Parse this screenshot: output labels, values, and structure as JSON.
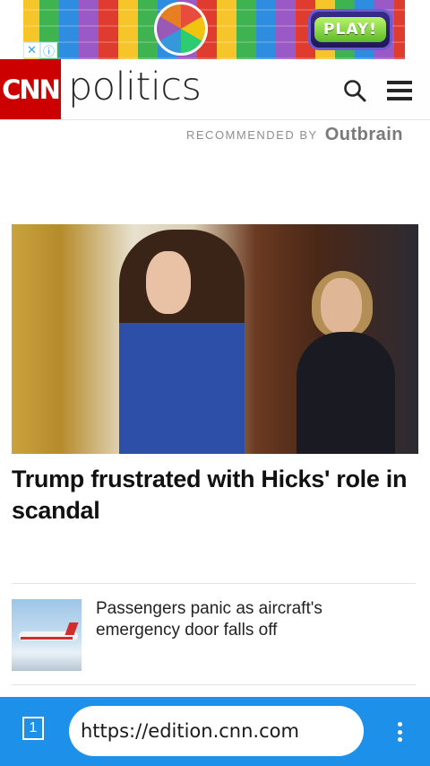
{
  "ad": {
    "play_label": "PLAY!",
    "close_label": "✕",
    "info_label": "ⓘ"
  },
  "header": {
    "logo": "CNN",
    "section_title": "politics",
    "search_icon": "search-icon",
    "menu_icon": "menu-icon",
    "brand_color": "#cc0000"
  },
  "recommended": {
    "text": "RECOMMENDED BY",
    "provider": "Outbrain"
  },
  "articles": [
    {
      "title": "Trump frustrated with Hicks' role in scandal",
      "image": "photo of woman in blue floral dress"
    },
    {
      "title": "Passengers panic as aircraft's emergency door falls off",
      "image": "airplane in flight thumbnail"
    }
  ],
  "browser": {
    "tab_count": "1",
    "url": "https://edition.cnn.com",
    "more_icon": "more-vertical-icon",
    "bar_color": "#1d90ea"
  }
}
